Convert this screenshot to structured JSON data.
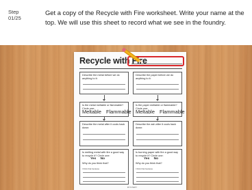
{
  "step": {
    "label": "Step",
    "number": "01/25"
  },
  "instruction": "Get a copy of the Recycle with Fire worksheet. Write your name at the top. We will use this sheet to record what we see in the foundry.",
  "worksheet": {
    "title": "Recycle with Fire",
    "box1": "Describe the metal before we do anything to it:",
    "box2": "Describe the paper before we do anything to it:",
    "box3": "Is the metal meltable or flammable? Circle one:",
    "box4": "Is the paper meltable or flammable? Circle one:",
    "meltable": "Meltable",
    "flammable": "Flammable",
    "box5": "Describe the metal after it cools back down:",
    "box6": "Describe the ash after it cools back down:",
    "box7": "Is melting metal with fire a good way to recycle it? Circle one:",
    "box8": "Is burning paper with fire a good way to recycle it? Circle one:",
    "yes": "Yes",
    "no": "No",
    "why": "Why do you think that?",
    "i_think": "I think that because",
    "footer": "MYSTERY"
  },
  "colors": {
    "highlight": "#d8262a",
    "pencil": "#f2b51c",
    "wood": "#d79a60"
  },
  "icons": {
    "pencil": "pencil-icon",
    "arrow": "down-arrow-icon"
  }
}
